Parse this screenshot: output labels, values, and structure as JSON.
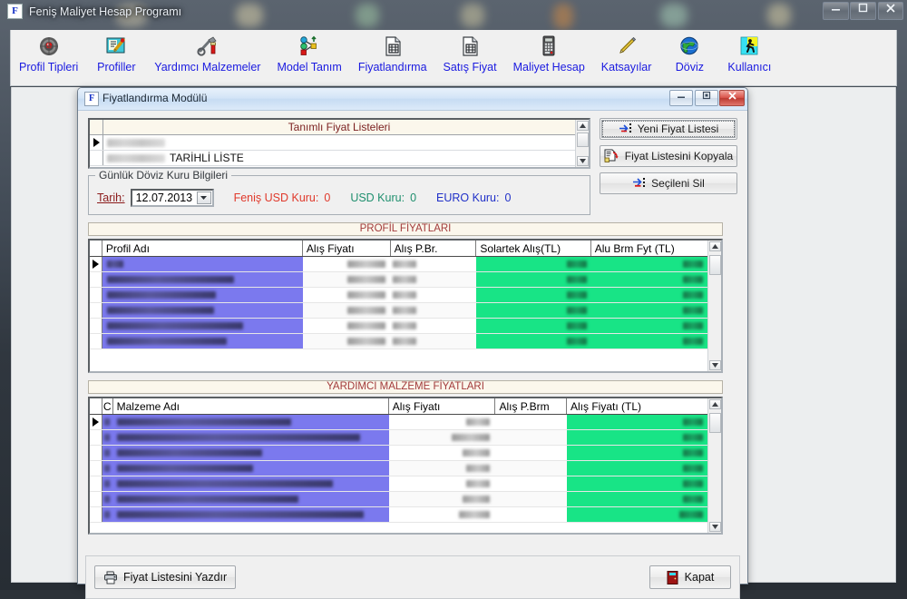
{
  "main_window": {
    "title": "Feniş Maliyet Hesap Programı",
    "app_icon_letter": "F",
    "controls": {
      "minimize": "minimize-icon",
      "maximize": "maximize-icon",
      "close": "close-icon"
    }
  },
  "toolbar": {
    "items": [
      {
        "label": "Profil Tipleri",
        "icon": "target-profile-icon"
      },
      {
        "label": "Profiller",
        "icon": "edit-note-icon"
      },
      {
        "label": "Yardımcı Malzemeler",
        "icon": "tools-icon"
      },
      {
        "label": "Model Tanım",
        "icon": "model-nodes-icon"
      },
      {
        "label": "Fiyatlandırma",
        "icon": "document-hash-icon"
      },
      {
        "label": "Satış Fiyat",
        "icon": "document-hash-icon"
      },
      {
        "label": "Maliyet Hesap",
        "icon": "calculator-icon"
      },
      {
        "label": "Katsayılar",
        "icon": "pencil-icon"
      },
      {
        "label": "Döviz",
        "icon": "globe-icon"
      },
      {
        "label": "Kullanıcı",
        "icon": "person-running-icon"
      }
    ]
  },
  "dialog": {
    "title": "Fiyatlandırma Modülü",
    "icon_letter": "F",
    "controls": {
      "minimize": "minimize-icon",
      "restore": "restore-icon",
      "close": "close-icon"
    },
    "price_lists": {
      "header": "Tanımlı Fiyat Listeleri",
      "rows": [
        {
          "date": "",
          "name": "",
          "selected": true
        },
        {
          "date": "",
          "name": "TARİHLİ LİSTE",
          "selected": false
        }
      ]
    },
    "buttons": {
      "new_price_list": "Yeni Fiyat Listesi",
      "copy_price_list": "Fiyat Listesini Kopyala",
      "delete_selected": "Seçileni Sil"
    },
    "fx_group": {
      "legend": "Günlük Döviz Kuru Bilgileri",
      "date_label": "Tarih:",
      "date_value": "12.07.2013",
      "rates": [
        {
          "label": "Feniş USD Kuru:",
          "value": "0",
          "color": "#e0392b"
        },
        {
          "label": "USD Kuru:",
          "value": "0",
          "color": "#1f8f6e"
        },
        {
          "label": "EURO Kuru:",
          "value": "0",
          "color": "#2030c8"
        }
      ]
    },
    "profile_section": {
      "banner": "PROFİL FİYATLARI",
      "columns": [
        "Profil Adı",
        "Alış Fiyatı",
        "Alış P.Br.",
        "Solartek Alış(TL)",
        "Alu Brm Fyt (TL)"
      ],
      "rows": [
        {
          "name": "",
          "price": "",
          "currency": "",
          "solartek": "",
          "alu": "",
          "current": true
        },
        {
          "name": "",
          "price": "",
          "currency": "",
          "solartek": "",
          "alu": "",
          "current": false
        },
        {
          "name": "",
          "price": "",
          "currency": "",
          "solartek": "",
          "alu": "",
          "current": false
        },
        {
          "name": "",
          "price": "",
          "currency": "",
          "solartek": "",
          "alu": "",
          "current": false
        },
        {
          "name": "",
          "price": "",
          "currency": "",
          "solartek": "",
          "alu": "",
          "current": false
        },
        {
          "name": "",
          "price": "",
          "currency": "",
          "solartek": "",
          "alu": "",
          "current": false
        }
      ]
    },
    "material_section": {
      "banner": "YARDIMCI MALZEME FİYATLARI",
      "columns": [
        "C",
        "Malzeme Adı",
        "Alış Fiyatı",
        "Alış P.Brm",
        "Alış Fiyatı (TL)"
      ],
      "rows": [
        {
          "code": "",
          "name": "",
          "price": "",
          "currency": "",
          "price_tl": "",
          "current": true
        },
        {
          "code": "",
          "name": "",
          "price": "",
          "currency": "",
          "price_tl": "",
          "current": false
        },
        {
          "code": "",
          "name": "",
          "price": "",
          "currency": "",
          "price_tl": "",
          "current": false
        },
        {
          "code": "",
          "name": "",
          "price": "",
          "currency": "",
          "price_tl": "",
          "current": false
        },
        {
          "code": "",
          "name": "",
          "price": "",
          "currency": "",
          "price_tl": "",
          "current": false
        },
        {
          "code": "",
          "name": "",
          "price": "",
          "currency": "",
          "price_tl": "",
          "current": false
        },
        {
          "code": "",
          "name": "",
          "price": "",
          "currency": "",
          "price_tl": "",
          "current": false
        }
      ]
    },
    "footer": {
      "print": "Fiyat Listesini Yazdır",
      "close": "Kapat"
    }
  },
  "colors": {
    "toolbar_label": "#1a1ae0",
    "banner_text": "#a23a3a",
    "grid_selected": "#7b79ee",
    "grid_green": "#18e486",
    "dialog_title_bg": "#cfe0f3"
  }
}
